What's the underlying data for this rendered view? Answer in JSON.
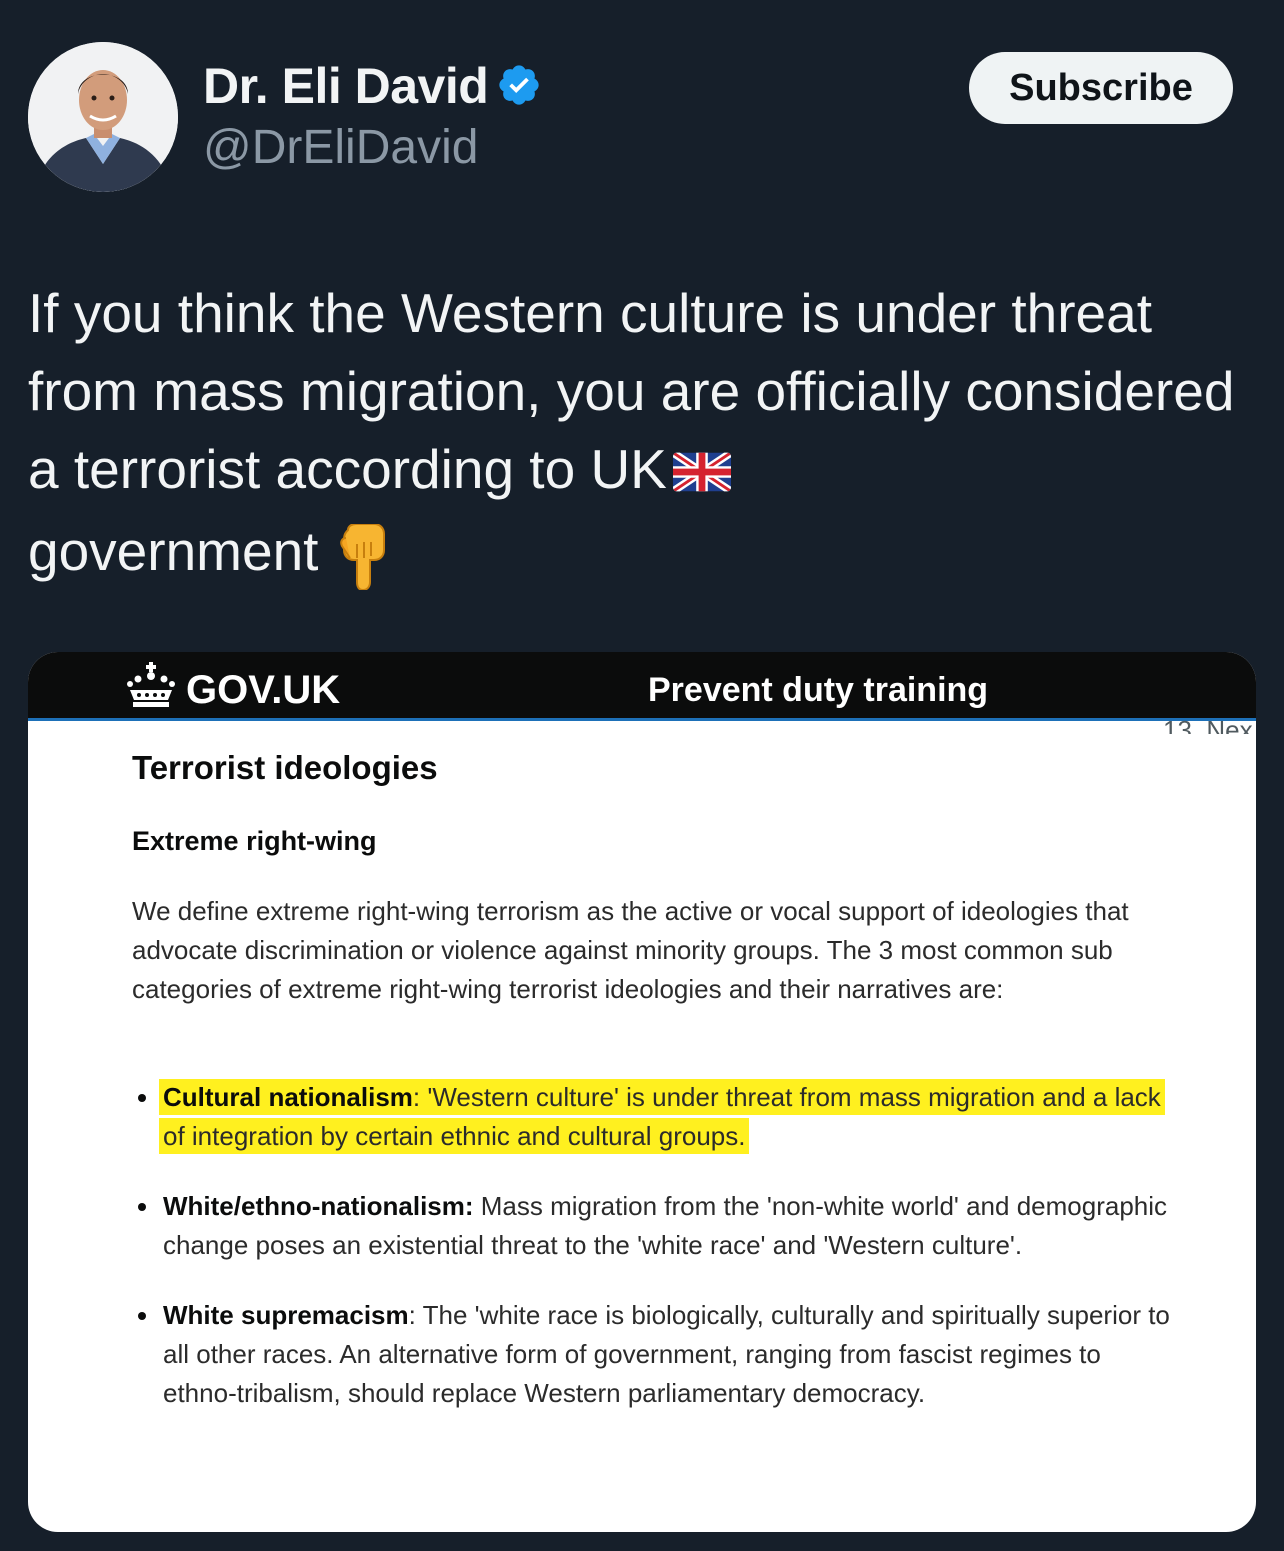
{
  "author": {
    "name": "Dr. Eli David",
    "handle": "@DrEliDavid",
    "verified": true
  },
  "subscribe_button": {
    "label": "Subscribe"
  },
  "tweet": {
    "text": "If you think the Western culture is under threat from mass migration, you are officially considered a terrorist according to UK",
    "text_tail": "government",
    "emojis": [
      "uk-flag",
      "backhand-index-pointing-down"
    ]
  },
  "media": {
    "header": {
      "logo_text": "GOV.UK",
      "service_name": "Prevent duty training",
      "nav_fragment": "13. Nex"
    },
    "section_title": "Terrorist ideologies",
    "subsection_title": "Extreme right-wing",
    "intro": "We define extreme right-wing terrorism as the active or vocal support of ideologies that advocate discrimination or violence against minority groups. The 3 most common sub categories of extreme right-wing terrorist ideologies and their narratives are:",
    "items": [
      {
        "term": "Cultural nationalism",
        "separator": ":",
        "text": " 'Western culture' is under threat from mass migration and a lack of integration by certain ethnic and cultural groups.",
        "highlighted": true
      },
      {
        "term": "White/ethno-nationalism:",
        "separator": "",
        "text": " Mass migration from the 'non-white world' and demographic change poses an existential threat to the 'white race' and 'Western culture'.",
        "highlighted": false
      },
      {
        "term": "White supremacism",
        "separator": ":",
        "text": " The 'white race is biologically, culturally and spiritually superior to all other races. An alternative form of government, ranging from fascist regimes to ethno-tribalism, should replace Western parliamentary democracy.",
        "highlighted": false
      }
    ]
  },
  "colors": {
    "background": "#161f2a",
    "verified_blue": "#1d9bf0",
    "highlight": "#fff01f",
    "gov_header": "#0b0c0c"
  }
}
